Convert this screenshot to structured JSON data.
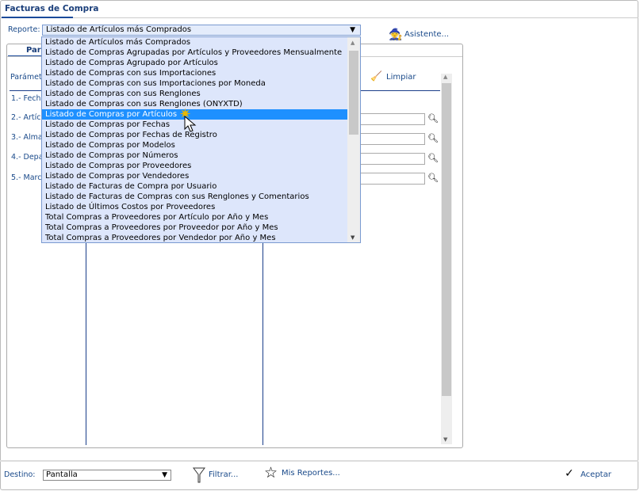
{
  "window": {
    "tab": "Facturas de Compra"
  },
  "report": {
    "label": "Reporte:",
    "selected": "Listado de Artículos más Comprados",
    "options": [
      "Listado de Artículos más Comprados",
      "Listado de Compras Agrupadas por Artículos y Proveedores Mensualmente",
      "Listado de Compras Agrupado por Artículos",
      "Listado de Compras con sus Importaciones",
      "Listado de Compras con sus Importaciones por Moneda",
      "Listado de Compras con sus Renglones",
      "Listado de Compras con sus Renglones (ONYXTD)",
      "Listado de Compras por Artículos",
      "Listado de Compras por Fechas",
      "Listado de Compras por Fechas de Registro",
      "Listado de Compras por Modelos",
      "Listado de Compras por Números",
      "Listado de Compras por Proveedores",
      "Listado de Compras por Vendedores",
      "Listado de Facturas de Compra por Usuario",
      "Listado de Facturas de Compras con sus Renglones y Comentarios",
      "Listado de Últimos Costos por Proveedores",
      "Total Compras a Proveedores por Artículo por Año y Mes",
      "Total Compras a Proveedores por Proveedor por Año y Mes",
      "Total Compras a Proveedores por Vendedor por Año y Mes"
    ],
    "highlighted_index": 7
  },
  "asistente": "Asistente...",
  "panel": {
    "tab": "Para",
    "header": "Parámet",
    "clear": "Limpiar",
    "params": [
      "1.- Fecha",
      "2.- Artíc",
      "3.- Alma",
      "4.- Depa",
      "5.- Marc"
    ]
  },
  "footer": {
    "destino_label": "Destino:",
    "destino_value": "Pantalla",
    "filter": "Filtrar...",
    "my_reports": "Mis Reportes...",
    "accept": "Aceptar"
  },
  "colors": {
    "accent": "#1a4a9a",
    "highlight": "#1e90ff",
    "dropdown_bg": "#dde6fb"
  }
}
